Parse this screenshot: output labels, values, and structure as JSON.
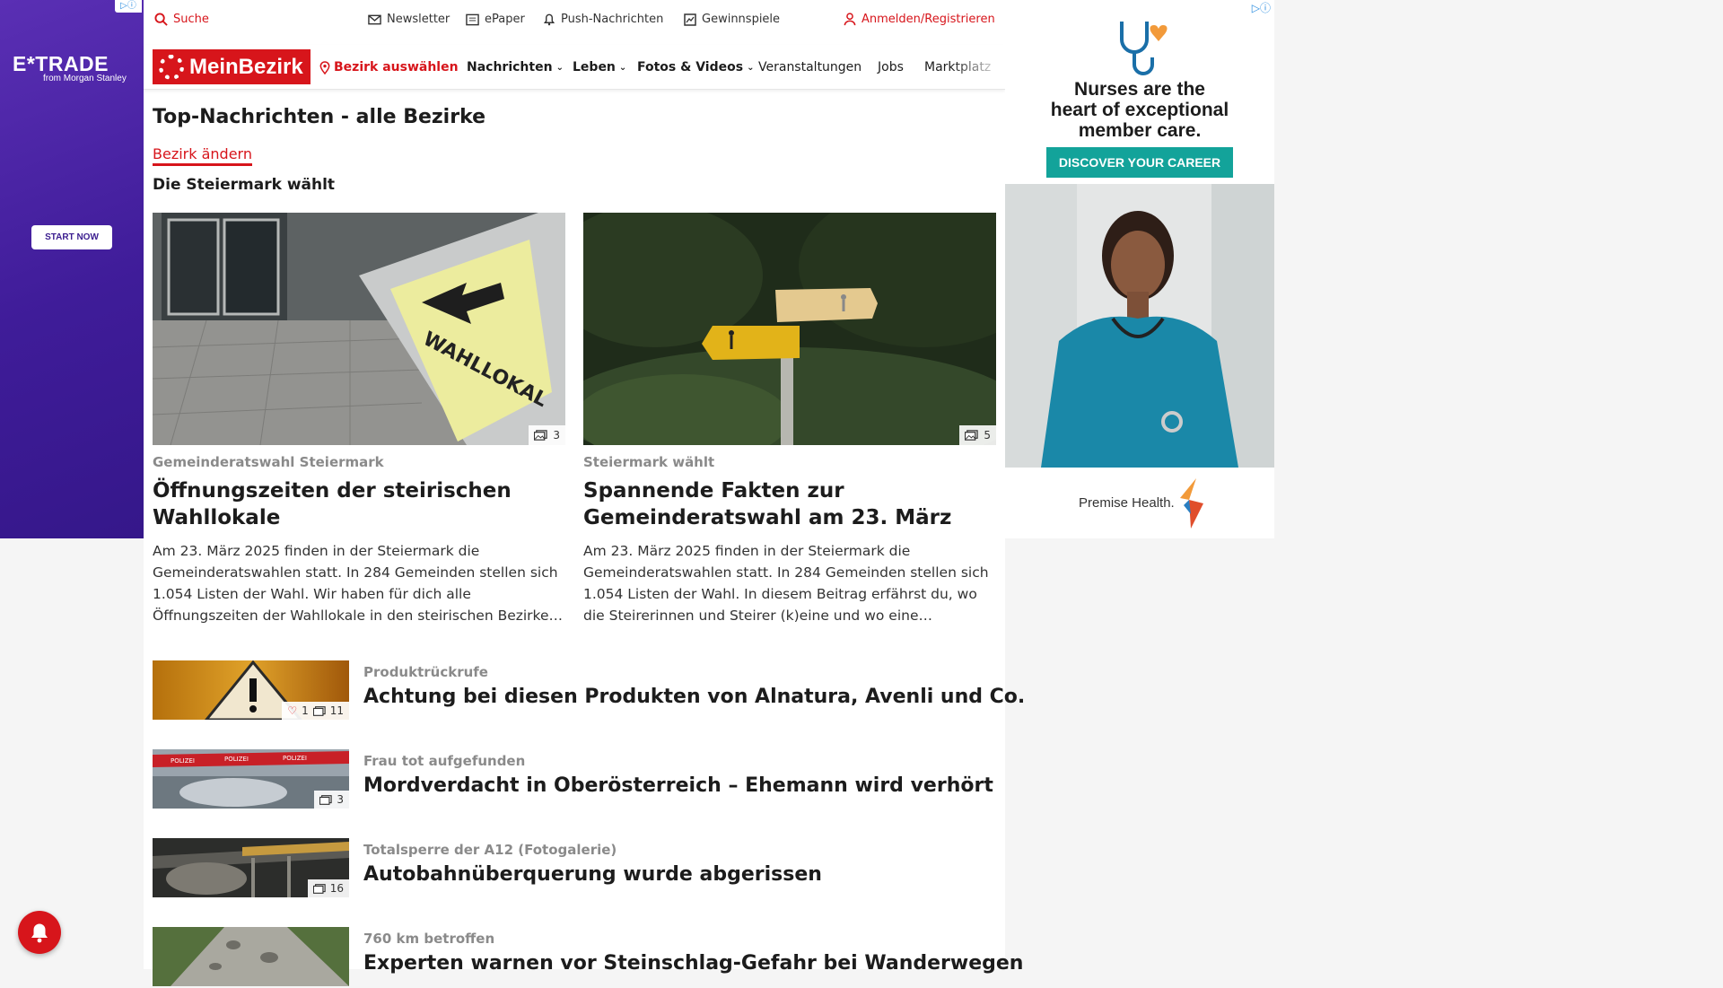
{
  "ad_left": {
    "adchoices": "▷ⓘ",
    "brand": "E*TRADE",
    "brand_sub": "from Morgan Stanley",
    "cta": "START NOW"
  },
  "topbar": {
    "search": "Suche",
    "newsletter": "Newsletter",
    "epaper": "ePaper",
    "push": "Push-Nachrichten",
    "gewinnspiele": "Gewinnspiele",
    "login": "Anmelden/Registrieren"
  },
  "nav": {
    "logo": "MeinBezirk",
    "bezirk_select": "Bezirk auswählen",
    "items": [
      "Nachrichten",
      "Leben",
      "Fotos & Videos",
      "Veranstaltungen",
      "Jobs",
      "Marktplatz"
    ]
  },
  "page": {
    "title": "Top-Nachrichten - alle Bezirke",
    "change_bezirk": "Bezirk ändern",
    "section": "Die Steiermark wählt"
  },
  "featured": [
    {
      "kicker": "Gemeinderatswahl Steiermark",
      "headline": "Öffnungszeiten der steirischen Wahllokale",
      "teaser": "Am 23. März 2025 finden in der Steiermark die Gemeinderatswahlen statt. In 284 Gemeinden stellen sich 1.054 Listen der Wahl. Wir haben für dich alle Öffnungszeiten der Wahllokale in den steirischen Bezirke…",
      "photos": "3",
      "sign_text": "WAHLLOKAL"
    },
    {
      "kicker": "Steiermark wählt",
      "headline": "Spannende Fakten zur Gemeinderatswahl am 23. März",
      "teaser": "Am 23. März 2025 finden in der Steiermark die Gemeinderatswahlen statt. In 284 Gemeinden stellen sich 1.054 Listen der Wahl. In diesem Beitrag erfährst du, wo die Steirerinnen und Steirer (k)eine und wo eine…",
      "photos": "5"
    }
  ],
  "list": [
    {
      "kicker": "Produktrückrufe",
      "headline": "Achtung bei diesen Produkten von Alnatura, Avenli und Co.",
      "likes": "1",
      "photos": "11"
    },
    {
      "kicker": "Frau tot aufgefunden",
      "headline": "Mordverdacht in Oberösterreich – Ehemann wird verhört",
      "photos": "3",
      "tape_text": "POLIZEI"
    },
    {
      "kicker": "Totalsperre der A12 (Fotogalerie)",
      "headline": "Autobahnüberquerung wurde abgerissen",
      "photos": "16"
    },
    {
      "kicker": "760 km betroffen",
      "headline": "Experten warnen vor Steinschlag-Gefahr bei Wanderwegen",
      "photos": ""
    }
  ],
  "ad_right": {
    "adchoices": "▷ⓘ",
    "headline_lines": [
      "Nurses are the",
      "heart of exceptional",
      "member care."
    ],
    "cta": "DISCOVER YOUR CAREER",
    "brand": "Premise Health."
  },
  "colors": {
    "brand_red": "#d7151b",
    "ad_purple": "#4a22a6",
    "ad_teal": "#13a39a"
  }
}
